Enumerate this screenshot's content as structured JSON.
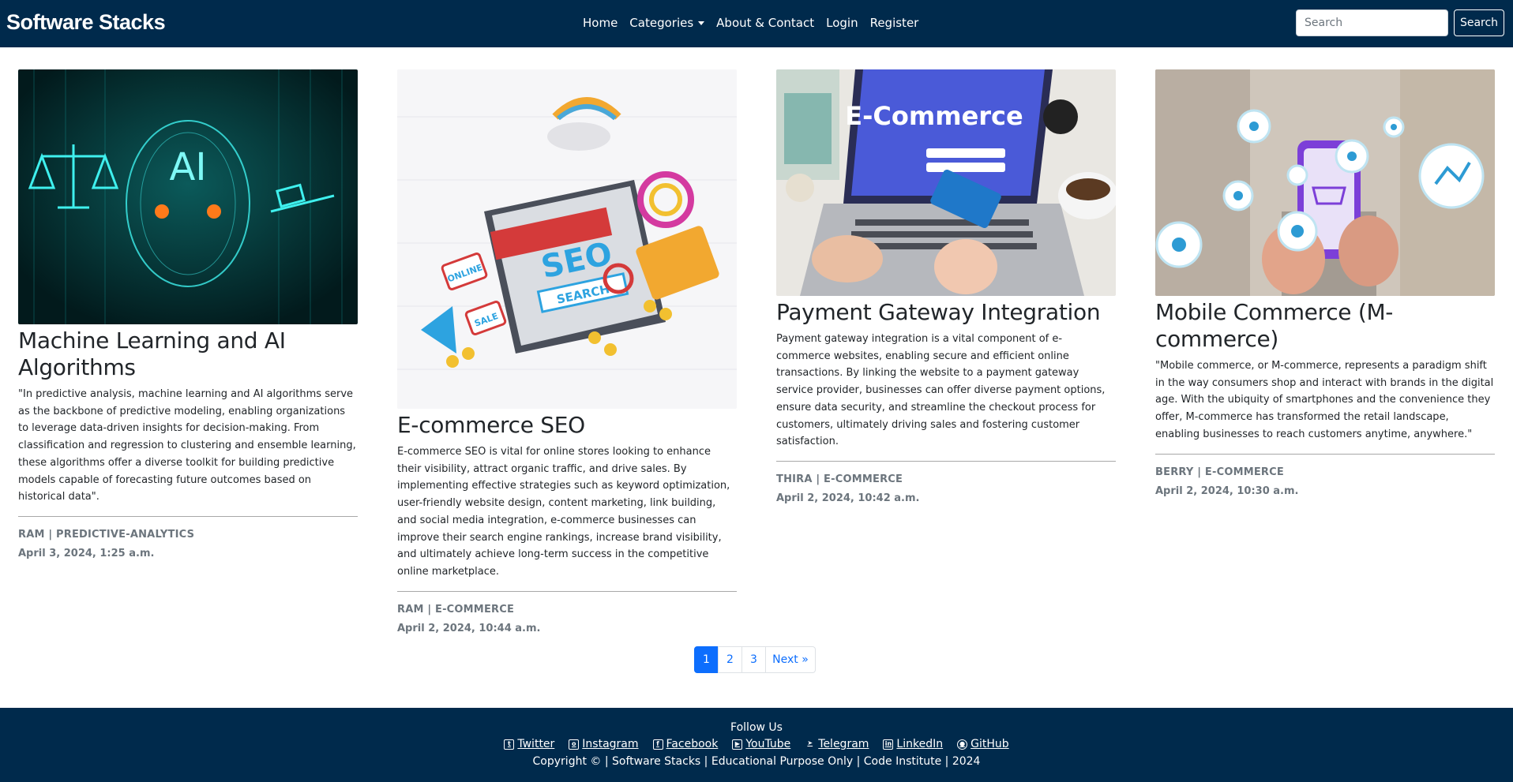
{
  "navbar": {
    "brand": "Software Stacks",
    "links": [
      "Home",
      "Categories",
      "About & Contact",
      "Login",
      "Register"
    ],
    "search_placeholder": "Search",
    "search_button": "Search"
  },
  "posts": [
    {
      "title": "Machine Learning and AI Algorithms",
      "excerpt": "\"In predictive analysis, machine learning and AI algorithms serve as the backbone of predictive modeling, enabling organizations to leverage data-driven insights for decision-making. From classification and regression to clustering and ensemble learning, these algorithms offer a diverse toolkit for building predictive models capable of forecasting future outcomes based on historical data\".",
      "meta": "RAM | PREDICTIVE-ANALYTICS",
      "date": "April 3, 2024, 1:25 a.m.",
      "image_label": "AI"
    },
    {
      "title": "E-commerce SEO",
      "excerpt": "E-commerce SEO is vital for online stores looking to enhance their visibility, attract organic traffic, and drive sales. By implementing effective strategies such as keyword optimization, user-friendly website design, content marketing, link building, and social media integration, e-commerce businesses can improve their search engine rankings, increase brand visibility, and ultimately achieve long-term success in the competitive online marketplace.",
      "meta": "RAM | E-COMMERCE",
      "date": "April 2, 2024, 10:44 a.m.",
      "image_labels": [
        "SEO",
        "SEARCH",
        "ONLINE",
        "SALE"
      ]
    },
    {
      "title": "Payment Gateway Integration",
      "excerpt": "Payment gateway integration is a vital component of e-commerce websites, enabling secure and efficient online transactions. By linking the website to a payment gateway service provider, businesses can offer diverse payment options, ensure data security, and streamline the checkout process for customers, ultimately driving sales and fostering customer satisfaction.",
      "meta": "THIRA | E-COMMERCE",
      "date": "April 2, 2024, 10:42 a.m.",
      "image_label": "E-Commerce"
    },
    {
      "title": "Mobile Commerce (M-commerce)",
      "excerpt": "\"Mobile commerce, or M-commerce, represents a paradigm shift in the way consumers shop and interact with brands in the digital age. With the ubiquity of smartphones and the convenience they offer, M-commerce has transformed the retail landscape, enabling businesses to reach customers anytime, anywhere.\"",
      "meta": "BERRY | E-COMMERCE",
      "date": "April 2, 2024, 10:30 a.m."
    }
  ],
  "pagination": {
    "pages": [
      "1",
      "2",
      "3"
    ],
    "next": "Next »",
    "active": "1"
  },
  "footer": {
    "follow": "Follow Us",
    "socials": [
      "Twitter",
      "Instagram",
      "Facebook",
      "YouTube",
      "Telegram",
      "LinkedIn",
      "GitHub"
    ],
    "copyright": "Copyright © | Software Stacks | Educational Purpose Only | Code Institute | 2024"
  },
  "colors": {
    "navbar_bg": "#002a4c",
    "accent": "#0d6efd",
    "meta_text": "#6c757d"
  }
}
